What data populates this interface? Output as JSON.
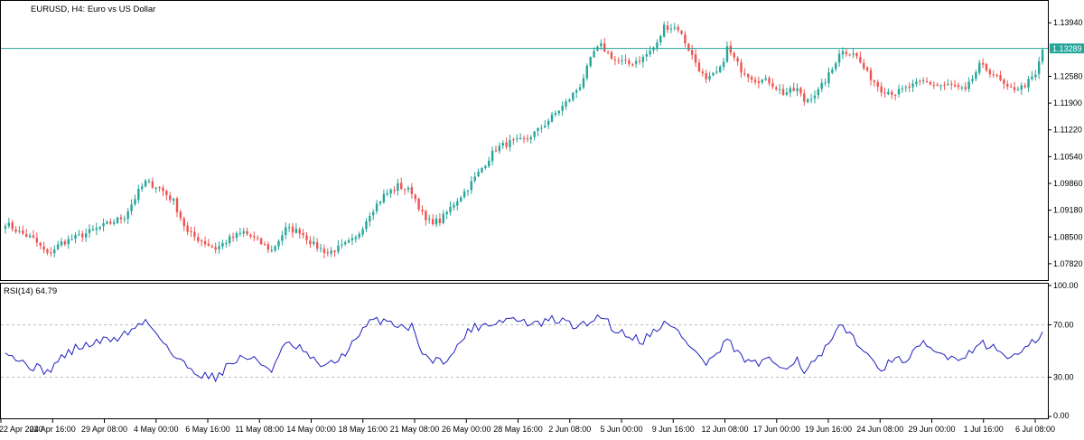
{
  "header": {
    "title": "EURUSD, H4:  Euro vs US Dollar",
    "icons": [
      "window-tile-icon",
      "chart-bars-icon"
    ]
  },
  "colors": {
    "bull": "#26a69a",
    "bear": "#ef5350",
    "price_line": "#26a69a",
    "rsi_line": "#1f1fbf",
    "grid_axis": "#000000",
    "level_line": "#bdbdbd"
  },
  "current_price": "1.13289",
  "chart_data": [
    {
      "type": "candlestick",
      "title": "EURUSD, H4:  Euro vs US Dollar",
      "ylim": [
        1.0745,
        1.1445
      ],
      "y_ticks": [
        "1.13940",
        "1.13289",
        "1.12580",
        "1.11900",
        "1.11220",
        "1.10540",
        "1.09860",
        "1.09180",
        "1.08500",
        "1.07820"
      ],
      "current_price": 1.13289,
      "x_ticks": [
        "22 Apr 2020",
        "24 Apr 16:00",
        "29 Apr 08:00",
        "4 May 00:00",
        "6 May 16:00",
        "11 May 08:00",
        "14 May 00:00",
        "18 May 16:00",
        "21 May 08:00",
        "26 May 00:00",
        "28 May 16:00",
        "2 Jun 08:00",
        "5 Jun 00:00",
        "9 Jun 16:00",
        "12 Jun 08:00",
        "17 Jun 00:00",
        "19 Jun 16:00",
        "24 Jun 08:00",
        "29 Jun 00:00",
        "1 Jul 16:00",
        "6 Jul 08:00"
      ],
      "close_anchors": [
        [
          0,
          1.0885
        ],
        [
          4,
          1.0862
        ],
        [
          8,
          1.0845
        ],
        [
          12,
          1.0805
        ],
        [
          16,
          1.0835
        ],
        [
          22,
          1.0855
        ],
        [
          28,
          1.0878
        ],
        [
          34,
          1.0902
        ],
        [
          38,
          1.0965
        ],
        [
          40,
          1.099
        ],
        [
          44,
          1.0975
        ],
        [
          48,
          1.094
        ],
        [
          52,
          1.086
        ],
        [
          56,
          1.084
        ],
        [
          60,
          1.082
        ],
        [
          64,
          1.0845
        ],
        [
          68,
          1.0862
        ],
        [
          72,
          1.084
        ],
        [
          76,
          1.0815
        ],
        [
          80,
          1.087
        ],
        [
          84,
          1.0865
        ],
        [
          88,
          1.083
        ],
        [
          92,
          1.081
        ],
        [
          96,
          1.0825
        ],
        [
          100,
          1.0845
        ],
        [
          104,
          1.091
        ],
        [
          108,
          1.0955
        ],
        [
          112,
          1.098
        ],
        [
          116,
          1.0965
        ],
        [
          120,
          1.089
        ],
        [
          124,
          1.089
        ],
        [
          128,
          1.0935
        ],
        [
          132,
          1.0975
        ],
        [
          136,
          1.1025
        ],
        [
          140,
          1.1075
        ],
        [
          144,
          1.109
        ],
        [
          148,
          1.1095
        ],
        [
          152,
          1.112
        ],
        [
          156,
          1.1155
        ],
        [
          160,
          1.119
        ],
        [
          164,
          1.1235
        ],
        [
          168,
          1.132
        ],
        [
          170,
          1.1335
        ],
        [
          174,
          1.13
        ],
        [
          178,
          1.129
        ],
        [
          182,
          1.1305
        ],
        [
          186,
          1.134
        ],
        [
          188,
          1.1385
        ],
        [
          192,
          1.138
        ],
        [
          196,
          1.131
        ],
        [
          200,
          1.1245
        ],
        [
          204,
          1.1275
        ],
        [
          206,
          1.133
        ],
        [
          210,
          1.1275
        ],
        [
          214,
          1.125
        ],
        [
          218,
          1.1245
        ],
        [
          222,
          1.1215
        ],
        [
          226,
          1.1225
        ],
        [
          228,
          1.1195
        ],
        [
          232,
          1.122
        ],
        [
          236,
          1.1275
        ],
        [
          238,
          1.132
        ],
        [
          242,
          1.132
        ],
        [
          246,
          1.1265
        ],
        [
          250,
          1.1225
        ],
        [
          254,
          1.1215
        ],
        [
          258,
          1.123
        ],
        [
          262,
          1.1245
        ],
        [
          266,
          1.1235
        ],
        [
          270,
          1.1235
        ],
        [
          274,
          1.122
        ],
        [
          278,
          1.1285
        ],
        [
          282,
          1.1265
        ],
        [
          286,
          1.1225
        ],
        [
          290,
          1.123
        ],
        [
          294,
          1.126
        ],
        [
          296,
          1.1325
        ]
      ],
      "candles_total": 297
    },
    {
      "type": "line",
      "title": "RSI(14) 64.79",
      "series": [
        {
          "name": "RSI(14)",
          "last": 64.79
        }
      ],
      "ylim": [
        0,
        100
      ],
      "y_ticks": [
        "100.00",
        "70.00",
        "30.00",
        "0.00"
      ],
      "levels": [
        70,
        30
      ],
      "rsi_anchors": [
        [
          0,
          52
        ],
        [
          4,
          42
        ],
        [
          8,
          38
        ],
        [
          12,
          34
        ],
        [
          16,
          45
        ],
        [
          20,
          52
        ],
        [
          24,
          55
        ],
        [
          28,
          58
        ],
        [
          32,
          60
        ],
        [
          36,
          66
        ],
        [
          40,
          73
        ],
        [
          44,
          62
        ],
        [
          48,
          46
        ],
        [
          52,
          38
        ],
        [
          56,
          32
        ],
        [
          60,
          30
        ],
        [
          64,
          40
        ],
        [
          68,
          46
        ],
        [
          72,
          42
        ],
        [
          76,
          36
        ],
        [
          80,
          55
        ],
        [
          84,
          52
        ],
        [
          88,
          42
        ],
        [
          92,
          38
        ],
        [
          96,
          46
        ],
        [
          100,
          58
        ],
        [
          104,
          72
        ],
        [
          108,
          74
        ],
        [
          112,
          70
        ],
        [
          116,
          68
        ],
        [
          120,
          45
        ],
        [
          124,
          42
        ],
        [
          128,
          48
        ],
        [
          132,
          66
        ],
        [
          136,
          70
        ],
        [
          140,
          72
        ],
        [
          144,
          75
        ],
        [
          148,
          72
        ],
        [
          152,
          70
        ],
        [
          156,
          74
        ],
        [
          160,
          72
        ],
        [
          164,
          68
        ],
        [
          168,
          74
        ],
        [
          170,
          78
        ],
        [
          174,
          66
        ],
        [
          178,
          62
        ],
        [
          182,
          58
        ],
        [
          186,
          68
        ],
        [
          188,
          71
        ],
        [
          192,
          65
        ],
        [
          196,
          52
        ],
        [
          200,
          40
        ],
        [
          204,
          50
        ],
        [
          206,
          58
        ],
        [
          210,
          45
        ],
        [
          214,
          40
        ],
        [
          218,
          42
        ],
        [
          222,
          38
        ],
        [
          226,
          44
        ],
        [
          228,
          35
        ],
        [
          232,
          44
        ],
        [
          236,
          58
        ],
        [
          238,
          68
        ],
        [
          242,
          62
        ],
        [
          246,
          45
        ],
        [
          250,
          38
        ],
        [
          254,
          42
        ],
        [
          258,
          45
        ],
        [
          262,
          55
        ],
        [
          266,
          48
        ],
        [
          270,
          46
        ],
        [
          274,
          45
        ],
        [
          278,
          58
        ],
        [
          282,
          52
        ],
        [
          286,
          46
        ],
        [
          290,
          48
        ],
        [
          294,
          58
        ],
        [
          296,
          64.79
        ]
      ]
    }
  ]
}
